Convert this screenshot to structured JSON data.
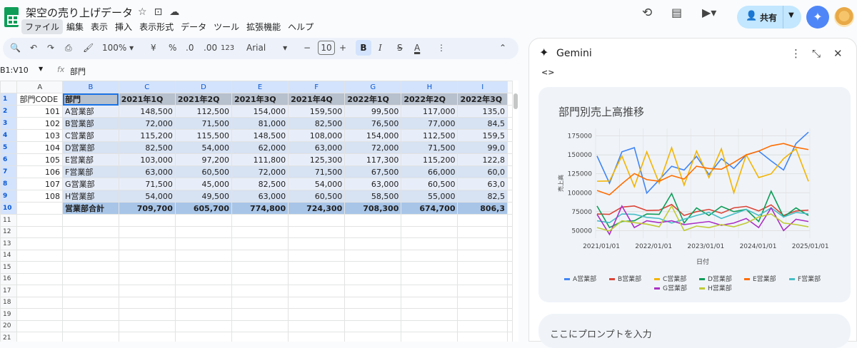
{
  "app": {
    "doc_title": "架空の売り上げデータ",
    "menu": [
      "ファイル",
      "編集",
      "表示",
      "挿入",
      "表示形式",
      "データ",
      "ツール",
      "拡張機能",
      "ヘルプ"
    ],
    "share_label": "共有"
  },
  "toolbar": {
    "zoom": "100%",
    "currency": "¥",
    "percent": "%",
    "dec_less": ".0",
    "dec_more": ".00",
    "format_num": "123",
    "font": "Arial",
    "font_size": "10",
    "bold": "B",
    "italic": "I",
    "strike": "S",
    "text_color": "A"
  },
  "formula_bar": {
    "name_box": "B1:V10",
    "fx": "fx",
    "value": "部門"
  },
  "sheet": {
    "columns": [
      "A",
      "B",
      "C",
      "D",
      "E",
      "F",
      "G",
      "H",
      "I"
    ],
    "header": [
      "部門CODE",
      "部門",
      "2021年1Q",
      "2021年2Q",
      "2021年3Q",
      "2021年4Q",
      "2022年1Q",
      "2022年2Q",
      "2022年3Q"
    ],
    "rows": [
      [
        "101",
        "A営業部",
        "148,500",
        "112,500",
        "154,000",
        "159,500",
        "99,500",
        "117,000",
        "135,0"
      ],
      [
        "102",
        "B営業部",
        "72,000",
        "71,500",
        "81,000",
        "82,500",
        "76,500",
        "77,000",
        "84,5"
      ],
      [
        "103",
        "C営業部",
        "115,200",
        "115,500",
        "148,500",
        "108,000",
        "154,000",
        "112,500",
        "159,5"
      ],
      [
        "104",
        "D営業部",
        "82,500",
        "54,000",
        "62,000",
        "63,000",
        "72,000",
        "71,500",
        "99,0"
      ],
      [
        "105",
        "E営業部",
        "103,000",
        "97,200",
        "111,800",
        "125,300",
        "117,300",
        "115,200",
        "122,8"
      ],
      [
        "106",
        "F営業部",
        "63,000",
        "60,500",
        "72,000",
        "71,500",
        "67,500",
        "66,000",
        "60,0"
      ],
      [
        "107",
        "G営業部",
        "71,500",
        "45,000",
        "82,500",
        "54,000",
        "63,000",
        "60,500",
        "63,0"
      ],
      [
        "108",
        "H営業部",
        "54,000",
        "49,500",
        "63,000",
        "60,500",
        "58,500",
        "55,000",
        "82,5"
      ]
    ],
    "total": [
      "",
      "営業部合計",
      "709,700",
      "605,700",
      "774,800",
      "724,300",
      "708,300",
      "674,700",
      "806,3"
    ],
    "row_numbers": [
      "1",
      "2",
      "3",
      "4",
      "5",
      "6",
      "7",
      "8",
      "9",
      "10",
      "11",
      "12",
      "13",
      "14",
      "15",
      "16",
      "17",
      "18",
      "19",
      "20",
      "21"
    ]
  },
  "gemini": {
    "title": "Gemini",
    "code_icon": "<>",
    "prompt_placeholder": "ここにプロンプトを入力"
  },
  "chart_data": {
    "type": "line",
    "title": "部門別売上高推移",
    "xlabel": "日付",
    "ylabel": "売上高",
    "x_ticks": [
      "2021/01/01",
      "2022/01/01",
      "2023/01/01",
      "2024/01/01",
      "2025/01/01"
    ],
    "y_ticks": [
      50000,
      75000,
      100000,
      125000,
      150000,
      175000
    ],
    "ylim": [
      40000,
      185000
    ],
    "x": [
      "2021-1Q",
      "2021-2Q",
      "2021-3Q",
      "2021-4Q",
      "2022-1Q",
      "2022-2Q",
      "2022-3Q",
      "2022-4Q",
      "2023-1Q",
      "2023-2Q",
      "2023-3Q",
      "2023-4Q",
      "2024-1Q",
      "2024-2Q",
      "2024-3Q",
      "2024-4Q",
      "2025-1Q",
      "2025-2Q"
    ],
    "legend_position": "bottom",
    "grid": true,
    "series": [
      {
        "name": "A営業部",
        "color": "#4285f4",
        "values": [
          148500,
          112500,
          154000,
          159500,
          99500,
          117000,
          135000,
          130000,
          148000,
          124000,
          145000,
          132000,
          150000,
          155000,
          142000,
          130000,
          165000,
          180000
        ]
      },
      {
        "name": "B営業部",
        "color": "#db4437",
        "values": [
          72000,
          71500,
          81000,
          82500,
          76500,
          77000,
          84500,
          70000,
          75000,
          78000,
          73000,
          80000,
          82000,
          76000,
          84000,
          70000,
          76000,
          77000
        ]
      },
      {
        "name": "C営業部",
        "color": "#f4b400",
        "values": [
          115200,
          115500,
          148500,
          108000,
          154000,
          112500,
          159500,
          110000,
          155000,
          120000,
          158000,
          100000,
          150000,
          120000,
          125000,
          145000,
          158000,
          115000
        ]
      },
      {
        "name": "D営業部",
        "color": "#0f9d58",
        "values": [
          82500,
          54000,
          62000,
          63000,
          72000,
          71500,
          99000,
          60000,
          80000,
          70000,
          82000,
          75000,
          78000,
          62000,
          102000,
          68000,
          80000,
          70000
        ]
      },
      {
        "name": "E営業部",
        "color": "#ff6d01",
        "values": [
          103000,
          97200,
          111800,
          125300,
          117300,
          115200,
          122800,
          118000,
          135000,
          132000,
          131000,
          140000,
          150000,
          155000,
          162000,
          165000,
          160000,
          157000
        ]
      },
      {
        "name": "F営業部",
        "color": "#46bdc6",
        "values": [
          63000,
          60500,
          72000,
          71500,
          67500,
          66000,
          60000,
          65000,
          70000,
          74000,
          66000,
          72000,
          78000,
          70000,
          80000,
          68000,
          74000,
          72000
        ]
      },
      {
        "name": "G営業部",
        "color": "#ab30c4",
        "values": [
          71500,
          45000,
          82500,
          54000,
          63000,
          60500,
          63000,
          58000,
          60000,
          62000,
          57000,
          60000,
          66000,
          54000,
          80000,
          50000,
          65000,
          62000
        ]
      },
      {
        "name": "H営業部",
        "color": "#c0ca33",
        "values": [
          54000,
          49500,
          63000,
          60500,
          58500,
          55000,
          82500,
          50000,
          56000,
          54000,
          58000,
          55000,
          60000,
          68000,
          72000,
          60000,
          58000,
          55000
        ]
      }
    ]
  }
}
